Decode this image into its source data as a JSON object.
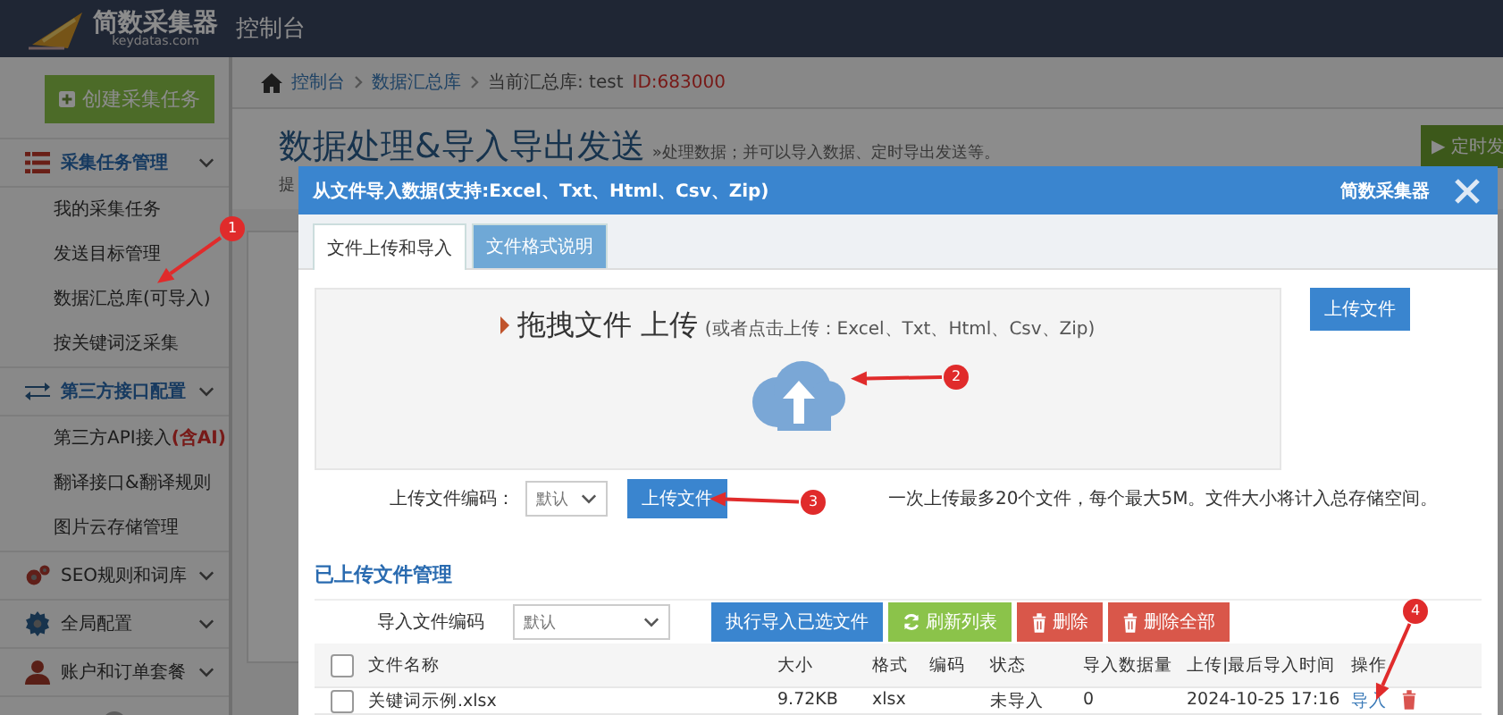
{
  "topbar": {
    "logo_name": "简数采集器",
    "logo_domain": "keydatas.com",
    "title": "控制台"
  },
  "sidebar": {
    "create_button": "创建采集任务",
    "groups": [
      {
        "label": "采集任务管理",
        "expanded": true,
        "children": [
          {
            "label": "我的采集任务"
          },
          {
            "label": "发送目标管理"
          },
          {
            "label": "数据汇总库(可导入)"
          },
          {
            "label": "按关键词泛采集"
          }
        ]
      },
      {
        "label": "第三方接口配置",
        "expanded": true,
        "children": [
          {
            "label": "第三方API接入**(含AI)**"
          },
          {
            "label": "翻译接口&翻译规则"
          },
          {
            "label": "图片云存储管理"
          }
        ]
      },
      {
        "label": "SEO规则和词库",
        "expanded": false
      },
      {
        "label": "全局配置",
        "expanded": false
      },
      {
        "label": "账户和订单套餐",
        "expanded": false
      }
    ]
  },
  "breadcrumb": {
    "items": [
      {
        "label": "控制台"
      },
      {
        "label": "数据汇总库"
      },
      {
        "label": "当前汇总库: test"
      }
    ],
    "id": "ID:683000"
  },
  "page": {
    "title": "数据处理&导入导出发送",
    "subtitle": "»处理数据；并可以导入数据、定时导出发送等。",
    "hint": "提",
    "action_button": "▶ 定时发"
  },
  "dialog": {
    "title": "从文件导入数据(支持:Excel、Txt、Html、Csv、Zip)",
    "brand": "简数采集器",
    "tabs": [
      {
        "label": "文件上传和导入",
        "selected": true
      },
      {
        "label": "文件格式说明",
        "selected": false
      }
    ],
    "dropzone": {
      "title": "拖拽文件 上传",
      "hint": "(或者点击上传：Excel、Txt、Html、Csv、Zip)"
    },
    "side_upload_button": "上传文件",
    "upload_row": {
      "label": "上传文件编码：",
      "select": "默认",
      "button": "上传文件",
      "note": "一次上传最多20个文件，每个最大5M。文件大小将计入总存储空间。"
    },
    "section_title": "已上传文件管理",
    "import_row": {
      "label": "导入文件编码",
      "select": "默认",
      "buttons": [
        {
          "label": "执行导入已选文件",
          "kind": "primary"
        },
        {
          "label": "刷新列表",
          "kind": "refresh"
        },
        {
          "label": "删除",
          "kind": "delete"
        },
        {
          "label": "删除全部",
          "kind": "delete"
        }
      ]
    },
    "table": {
      "header_checked": false,
      "columns": [
        "文件名称",
        "大小",
        "格式",
        "编码",
        "状态",
        "导入数据量",
        "上传|最后导入时间",
        "操作"
      ],
      "rows": [
        {
          "checked": false,
          "name": "关键词示例.xlsx",
          "size": "9.72KB",
          "format": "xlsx",
          "status": "未导入",
          "count": "0",
          "time": "2024-10-25 17:16",
          "action": "导入"
        }
      ]
    }
  },
  "annotations": [
    {
      "label": "1"
    },
    {
      "label": "2"
    },
    {
      "label": "3"
    },
    {
      "label": "4"
    }
  ]
}
